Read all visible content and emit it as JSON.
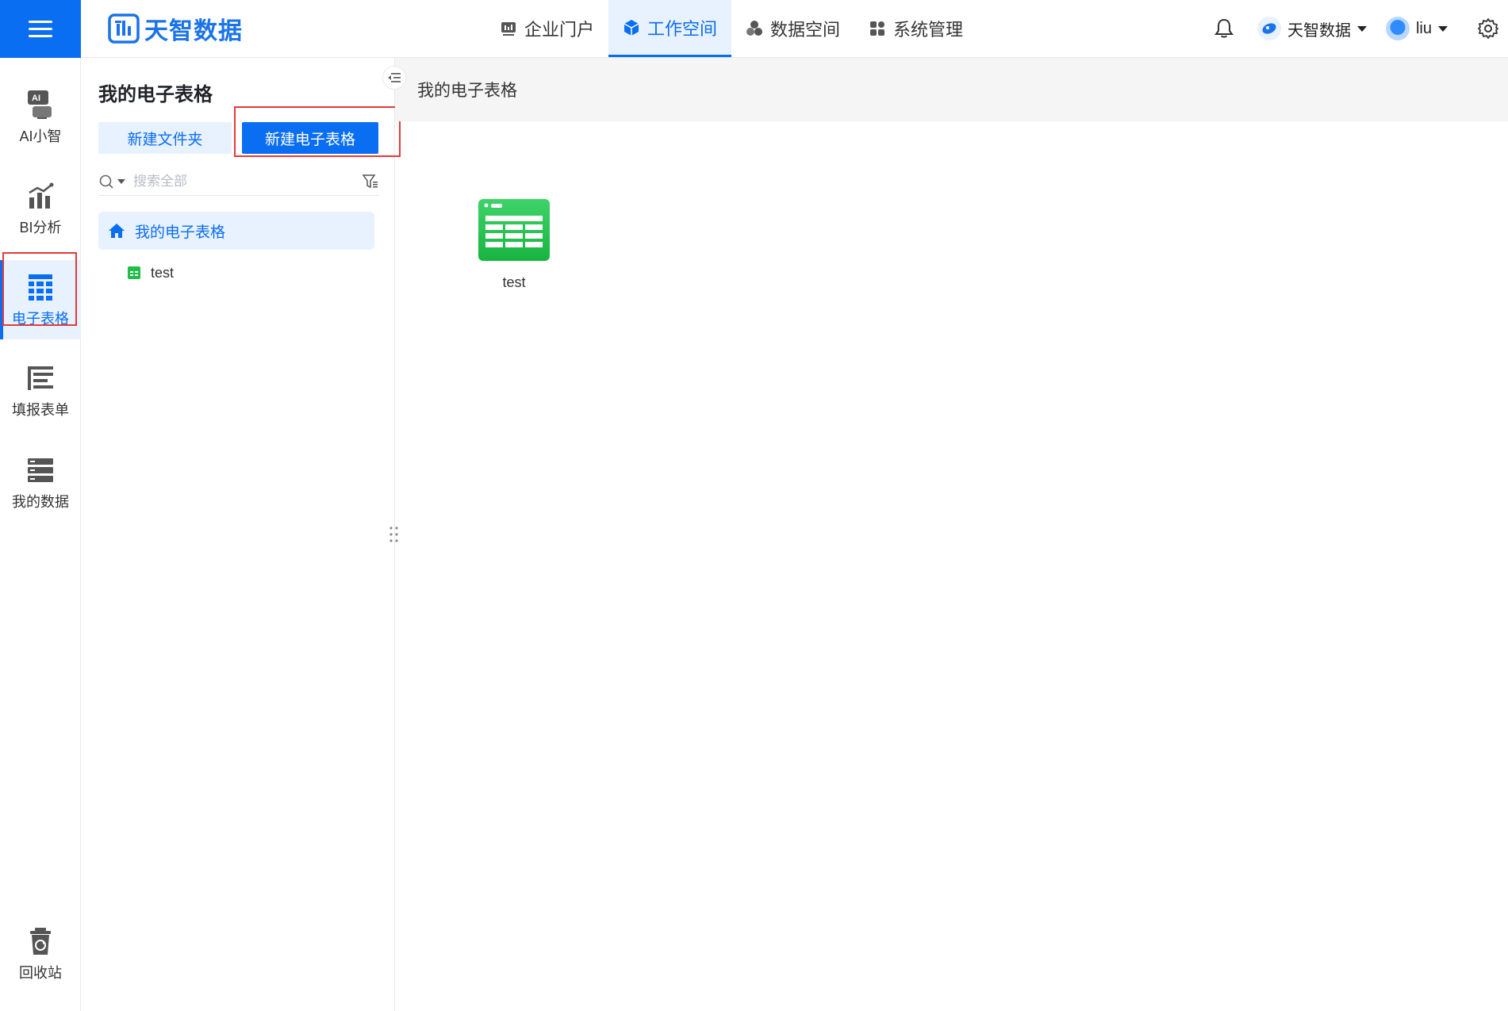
{
  "header": {
    "brand": "天智数据",
    "nav": [
      {
        "label": "企业门户",
        "icon": "portal-icon",
        "active": false
      },
      {
        "label": "工作空间",
        "icon": "cube-icon",
        "active": true
      },
      {
        "label": "数据空间",
        "icon": "data-space-icon",
        "active": false
      },
      {
        "label": "系统管理",
        "icon": "grid-icon",
        "active": false
      }
    ],
    "org_name": "天智数据",
    "user_name": "liu"
  },
  "rail": {
    "items": [
      {
        "label": "AI小智",
        "icon": "ai-assistant-icon"
      },
      {
        "label": "BI分析",
        "icon": "bi-chart-icon"
      },
      {
        "label": "电子表格",
        "icon": "spreadsheet-icon",
        "active": true
      },
      {
        "label": "填报表单",
        "icon": "form-icon"
      },
      {
        "label": "我的数据",
        "icon": "database-icon"
      }
    ],
    "recycle": {
      "label": "回收站",
      "icon": "recycle-bin-icon"
    }
  },
  "panel": {
    "title": "我的电子表格",
    "new_folder_label": "新建文件夹",
    "new_sheet_label": "新建电子表格",
    "search_placeholder": "搜索全部",
    "tree_root": "我的电子表格",
    "tree_children": [
      "test"
    ]
  },
  "main": {
    "breadcrumb": "我的电子表格",
    "files": [
      {
        "name": "test",
        "type": "spreadsheet"
      }
    ]
  },
  "colors": {
    "accent": "#0a6ef2",
    "accent_light": "#e8f1fe",
    "highlight": "#e23b3b",
    "sheet_green": "#1fbf4a"
  }
}
